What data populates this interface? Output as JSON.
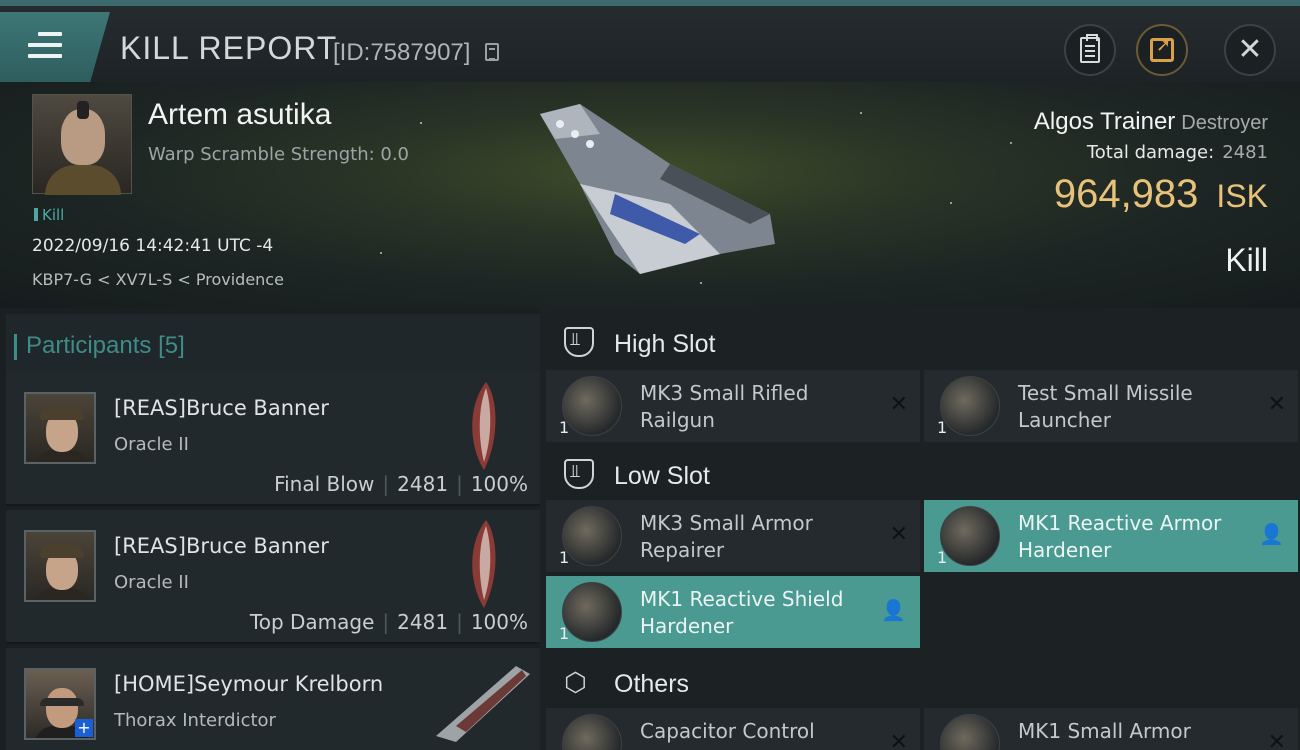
{
  "header": {
    "title": "KILL REPORT",
    "report_id": "[ID:7587907]",
    "icons": [
      "menu-icon",
      "copy-icon",
      "clipboard-icon",
      "share-icon",
      "close-icon"
    ]
  },
  "victim": {
    "name": "Artem asutika",
    "warp": "Warp Scramble Strength: 0.0",
    "tag": "Kill",
    "time": "2022/09/16 14:42:41 UTC -4",
    "location": "KBP7-G < XV7L-S < Providence",
    "ship": "Algos Trainer",
    "ship_class": "Destroyer",
    "total_damage_label": "Total damage:",
    "total_damage": "2481",
    "isk_value": "964,983",
    "isk_unit": "ISK",
    "result": "Kill"
  },
  "participants": {
    "title": "Participants",
    "count": "[5]",
    "rows": [
      {
        "name": "[REAS]Bruce Banner",
        "ship": "Oracle II",
        "label": "Final Blow",
        "damage": "2481",
        "percent": "100%"
      },
      {
        "name": "[REAS]Bruce Banner",
        "ship": "Oracle II",
        "label": "Top Damage",
        "damage": "2481",
        "percent": "100%"
      },
      {
        "name": "[HOME]Seymour Krelborn",
        "ship": "Thorax Interdictor"
      }
    ]
  },
  "fitting": {
    "high_slot": "High Slot",
    "low_slot": "Low Slot",
    "others": "Others",
    "high_modules": [
      {
        "name": "MK3 Small Rifled Railgun",
        "qty": "1"
      },
      {
        "name": "Test Small Missile Launcher",
        "qty": "1"
      }
    ],
    "low_modules": [
      {
        "name": "MK3 Small Armor Repairer",
        "qty": "1"
      },
      {
        "name": "MK1 Reactive Armor Hardener",
        "qty": "1"
      },
      {
        "name": "MK1 Reactive Shield Hardener",
        "qty": "1"
      }
    ],
    "other_modules": [
      {
        "name": "Capacitor Control",
        "qty": ""
      },
      {
        "name": "MK1 Small Armor",
        "qty": ""
      }
    ]
  },
  "colors": {
    "accent": "#4a9a92",
    "isk": "#e8c27a",
    "teal_text": "#3d8c89"
  }
}
